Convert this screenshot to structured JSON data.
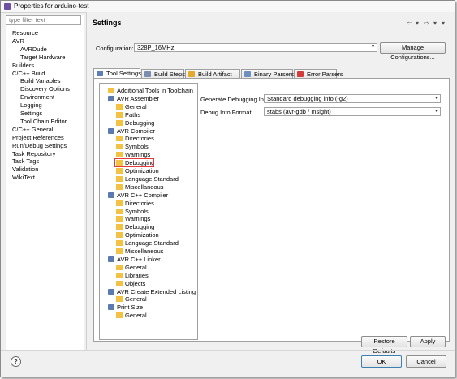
{
  "window": {
    "title": "Properties for arduino-test"
  },
  "filter": {
    "placeholder": "type filter text"
  },
  "nav": [
    {
      "label": "Resource",
      "level": 0
    },
    {
      "label": "AVR",
      "level": 0
    },
    {
      "label": "AVRDude",
      "level": 1
    },
    {
      "label": "Target Hardware",
      "level": 1
    },
    {
      "label": "Builders",
      "level": 0
    },
    {
      "label": "C/C++ Build",
      "level": 0
    },
    {
      "label": "Build Variables",
      "level": 1
    },
    {
      "label": "Discovery Options",
      "level": 1
    },
    {
      "label": "Environment",
      "level": 1
    },
    {
      "label": "Logging",
      "level": 1
    },
    {
      "label": "Settings",
      "level": 1
    },
    {
      "label": "Tool Chain Editor",
      "level": 1
    },
    {
      "label": "C/C++ General",
      "level": 0
    },
    {
      "label": "Project References",
      "level": 0
    },
    {
      "label": "Run/Debug Settings",
      "level": 0
    },
    {
      "label": "Task Repository",
      "level": 0
    },
    {
      "label": "Task Tags",
      "level": 0
    },
    {
      "label": "Validation",
      "level": 0
    },
    {
      "label": "WikiText",
      "level": 0
    }
  ],
  "page": {
    "title": "Settings",
    "configuration_label": "Configuration:",
    "configuration_value": "328P_16MHz",
    "manage_button": "Manage Configurations..."
  },
  "tabs": [
    {
      "label": "Tool Settings",
      "active": true,
      "icon_color": "#5b7fb5"
    },
    {
      "label": "Build Steps",
      "active": false,
      "icon_color": "#7a8fb0"
    },
    {
      "label": "Build Artifact",
      "active": false,
      "icon_color": "#e3a92b"
    },
    {
      "label": "Binary Parsers",
      "active": false,
      "icon_color": "#6f8fc0"
    },
    {
      "label": "Error Parsers",
      "active": false,
      "icon_color": "#d33a3a"
    }
  ],
  "tool_tree": [
    {
      "label": "Additional Tools in Toolchain",
      "level": 0,
      "type": "page"
    },
    {
      "label": "AVR Assembler",
      "level": 0,
      "type": "category"
    },
    {
      "label": "General",
      "level": 1,
      "type": "page"
    },
    {
      "label": "Paths",
      "level": 1,
      "type": "page"
    },
    {
      "label": "Debugging",
      "level": 1,
      "type": "page"
    },
    {
      "label": "AVR Compiler",
      "level": 0,
      "type": "category"
    },
    {
      "label": "Directories",
      "level": 1,
      "type": "page"
    },
    {
      "label": "Symbols",
      "level": 1,
      "type": "page"
    },
    {
      "label": "Warnings",
      "level": 1,
      "type": "page"
    },
    {
      "label": "Debugging",
      "level": 1,
      "type": "page",
      "selected": true
    },
    {
      "label": "Optimization",
      "level": 1,
      "type": "page"
    },
    {
      "label": "Language Standard",
      "level": 1,
      "type": "page"
    },
    {
      "label": "Miscellaneous",
      "level": 1,
      "type": "page"
    },
    {
      "label": "AVR C++ Compiler",
      "level": 0,
      "type": "category"
    },
    {
      "label": "Directories",
      "level": 1,
      "type": "page"
    },
    {
      "label": "Symbols",
      "level": 1,
      "type": "page"
    },
    {
      "label": "Warnings",
      "level": 1,
      "type": "page"
    },
    {
      "label": "Debugging",
      "level": 1,
      "type": "page"
    },
    {
      "label": "Optimization",
      "level": 1,
      "type": "page"
    },
    {
      "label": "Language Standard",
      "level": 1,
      "type": "page"
    },
    {
      "label": "Miscellaneous",
      "level": 1,
      "type": "page"
    },
    {
      "label": "AVR C++ Linker",
      "level": 0,
      "type": "category"
    },
    {
      "label": "General",
      "level": 1,
      "type": "page"
    },
    {
      "label": "Libraries",
      "level": 1,
      "type": "page"
    },
    {
      "label": "Objects",
      "level": 1,
      "type": "page"
    },
    {
      "label": "AVR Create Extended Listing",
      "level": 0,
      "type": "category"
    },
    {
      "label": "General",
      "level": 1,
      "type": "page"
    },
    {
      "label": "Print Size",
      "level": 0,
      "type": "category"
    },
    {
      "label": "General",
      "level": 1,
      "type": "page"
    }
  ],
  "fields": {
    "gen_debug_label": "Generate Debugging Info",
    "gen_debug_value": "Standard debugging info (-g2)",
    "debug_format_label": "Debug Info Format",
    "debug_format_value": "stabs (avr-gdb / Insight)"
  },
  "buttons": {
    "restore": "Restore Defaults",
    "apply": "Apply",
    "ok": "OK",
    "cancel": "Cancel"
  },
  "icons": {
    "help": "?",
    "back": "⇦",
    "forward": "⇨",
    "dropdown": "▾",
    "menu": "▾"
  },
  "colors": {
    "selection_border": "#e23a3a",
    "category_icon": "#5a7ab0",
    "page_icon": "#f2c243",
    "app_icon": "#6a4fa3"
  }
}
